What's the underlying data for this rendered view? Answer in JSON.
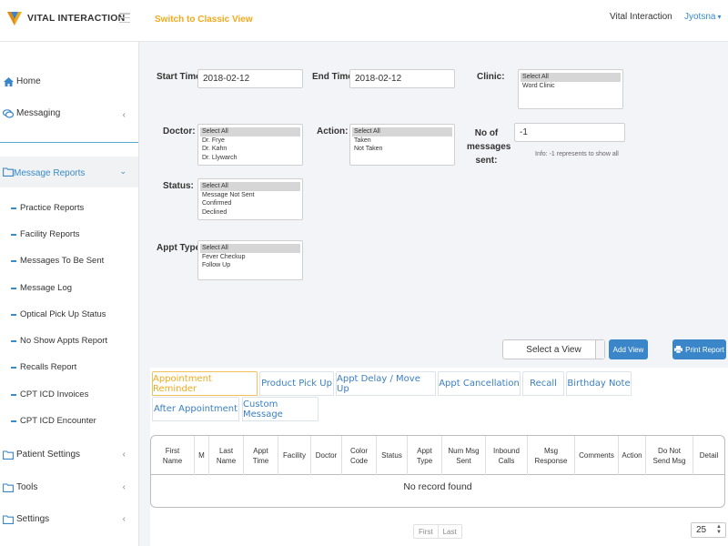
{
  "header": {
    "brand": "VITAL INTERACTION",
    "switch_view": "Switch to Classic View",
    "org_name": "Vital Interaction",
    "user_name": "Jyotsna",
    "accent": "#f2a91c",
    "link_color": "#3a8bc8"
  },
  "sidebar": {
    "home": "Home",
    "messaging": "Messaging",
    "message_reports": "Message Reports",
    "reports": [
      "Practice Reports",
      "Facility Reports",
      "Messages To Be Sent",
      "Message Log",
      "Optical Pick Up Status",
      "No Show Appts Report",
      "Recalls Report",
      "CPT ICD Invoices",
      "CPT ICD Encounter"
    ],
    "patient_settings": "Patient Settings",
    "tools": "Tools",
    "settings": "Settings"
  },
  "filters": {
    "start_time_label": "Start Time:",
    "start_time_value": "2018-02-12",
    "end_time_label": "End Time:",
    "end_time_value": "2018-02-12",
    "clinic_label": "Clinic:",
    "clinic_options": [
      "Select All",
      "Word Clinic"
    ],
    "doctor_label": "Doctor:",
    "doctor_options": [
      "Select All",
      "Dr. Frye",
      "Dr. Kahn",
      "Dr. Llywarch"
    ],
    "action_label": "Action:",
    "action_options": [
      "Select All",
      "Taken",
      "Not Taken"
    ],
    "nomsg_label_1": "No of",
    "nomsg_label_2": "messages",
    "nomsg_label_3": "sent:",
    "nomsg_value": "-1",
    "nomsg_info": "Info: -1 represents to show all",
    "status_label": "Status:",
    "status_options": [
      "Select All",
      "Message Not Sent",
      "Confirmed",
      "Declined"
    ],
    "appt_type_label": "Appt Type:",
    "appt_type_options": [
      "Select All",
      "Fever Checkup",
      "Follow Up"
    ]
  },
  "actions": {
    "select_view": "Select a View",
    "add_view": "Add View",
    "print_report": "Print Report"
  },
  "tabs": {
    "row1": [
      "Appointment Reminder",
      "Product Pick Up",
      "Appt Delay / Move Up",
      "Appt Cancellation",
      "Recall",
      "Birthday Note"
    ],
    "row2": [
      "After Appointment",
      "Custom Message"
    ],
    "active": "Appointment Reminder"
  },
  "table": {
    "columns": [
      [
        "First",
        "Name"
      ],
      [
        "M"
      ],
      [
        "Last",
        "Name"
      ],
      [
        "Appt",
        "Time"
      ],
      [
        "Facility"
      ],
      [
        "Doctor"
      ],
      [
        "Color",
        "Code"
      ],
      [
        "Status"
      ],
      [
        "Appt",
        "Type"
      ],
      [
        "Num Msg",
        "Sent"
      ],
      [
        "Inbound",
        "Calls"
      ],
      [
        "Msg",
        "Response"
      ],
      [
        "Comments"
      ],
      [
        "Action"
      ],
      [
        "Do Not",
        "Send Msg"
      ],
      [
        "Detail"
      ]
    ],
    "empty_text": "No record found"
  },
  "pagination": {
    "first": "First",
    "last": "Last",
    "page_size": "25"
  }
}
